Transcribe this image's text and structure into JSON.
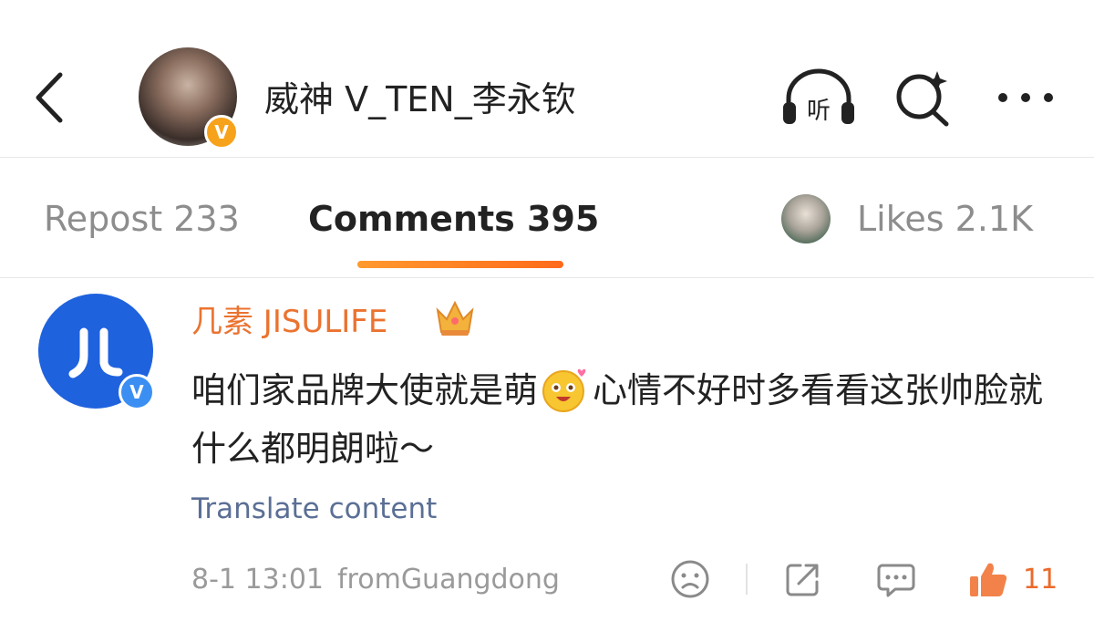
{
  "header": {
    "username": "威神 V_TEN_李永钦",
    "verified_badge": "V",
    "listen_label": "听",
    "icons": [
      "back-icon",
      "listen-icon",
      "search-sparkle-icon",
      "more-icon"
    ]
  },
  "tabs": {
    "repost": "Repost 233",
    "comments": "Comments 395",
    "likes": "Likes 2.1K",
    "active": "comments"
  },
  "comment": {
    "avatar_text": "八",
    "verified_badge": "V",
    "author": "几素 JISULIFE",
    "text_part1": "咱们家品牌大使就是萌",
    "text_part2": "心情不好时多看看这张帅脸就什么都明朗啦～",
    "translate_label": "Translate content",
    "time": "8-1 13:01",
    "location": "fromGuangdong",
    "like_count": "11",
    "icons": [
      "crown-icon",
      "cute-emoji-icon",
      "sad-face-icon",
      "share-icon",
      "reply-icon",
      "thumbs-up-icon"
    ]
  },
  "colors": {
    "accent_orange": "#eb7330",
    "link_blue": "#5b6f95",
    "brand_blue": "#1f62de",
    "badge_orange": "#f7a21b"
  }
}
